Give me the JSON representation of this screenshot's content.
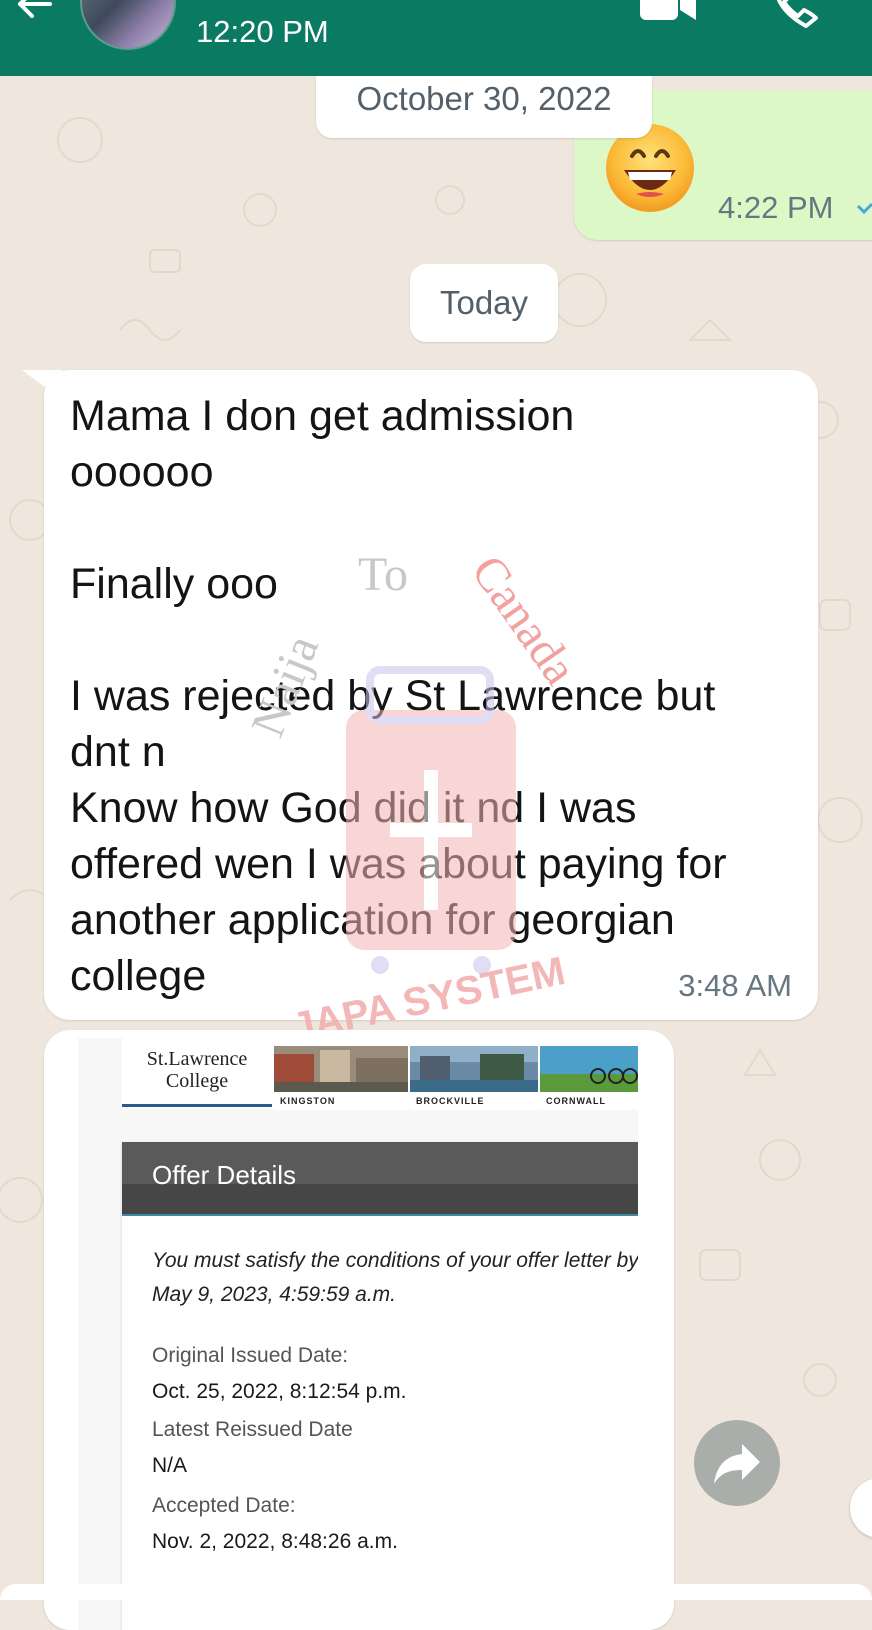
{
  "header": {
    "status_text": "12:20 PM"
  },
  "messages": {
    "date_oct": "October 30, 2022",
    "out_time": "4:22 PM",
    "date_today": "Today",
    "in_text": "Mama I don get admission\noooooo\n\nFinally ooo\n\nI was rejected by St Lawrence but\ndnt n\nKnow how God did it nd I was\noffered wen I was about paying for\nanother application for georgian\ncollege",
    "in_time": "3:48 AM"
  },
  "watermark": {
    "line1": "Naija",
    "line2": "To",
    "line3": "Canada",
    "line4": "JAPA SYSTEM"
  },
  "offer_doc": {
    "college_line1": "St.Lawrence",
    "college_line2": "College",
    "campuses": [
      "KINGSTON",
      "BROCKVILLE",
      "CORNWALL"
    ],
    "title": "Offer Details",
    "note": "You must satisfy the conditions of your offer letter by May 9, 2023, 4:59:59 a.m.",
    "original_issued_label": "Original Issued Date:",
    "original_issued_value": "Oct. 25, 2022, 8:12:54 p.m.",
    "latest_reissued_label": "Latest Reissued Date",
    "latest_reissued_value": "N/A",
    "accepted_label": "Accepted Date:",
    "accepted_value": "Nov. 2, 2022, 8:48:26 a.m."
  },
  "colors": {
    "header": "#0b7a63",
    "outgoing_bubble": "#dcf8c6",
    "chat_background": "#efe7dd"
  },
  "icons": {
    "back": "back-arrow-icon",
    "video": "video-call-icon",
    "call": "phone-call-icon",
    "forward": "forward-icon",
    "tick": "single-tick-icon"
  }
}
